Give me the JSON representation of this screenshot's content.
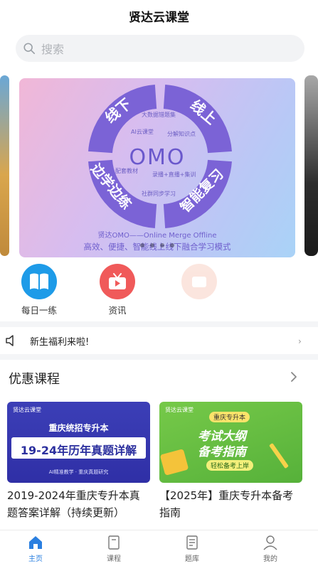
{
  "header": {
    "title": "贤达云课堂"
  },
  "search": {
    "placeholder": "搜索",
    "icon": "search-icon"
  },
  "banner": {
    "ring_words": [
      "线下",
      "线上",
      "边学边练",
      "智能复习"
    ],
    "center": "OMO",
    "mini_labels": [
      "大数据错题集",
      "AI云课堂",
      "分解知识点",
      "配套教材",
      "录播+直播+集训",
      "社群同步学习"
    ],
    "line1": "贤达OMO——Online Merge Offline",
    "line2": "高效、便捷、智能线上线下融合学习模式",
    "ring_color": "#7b63d6"
  },
  "quick_links": [
    {
      "label": "每日一练",
      "icon": "book-icon",
      "color": "#1e9be8"
    },
    {
      "label": "资讯",
      "icon": "tv-icon",
      "color": "#f05a5a"
    },
    {
      "label": "",
      "icon": "faded-icon",
      "color": "#f7c7b8"
    }
  ],
  "notice": {
    "text": "新生福利来啦!",
    "icon": "speaker-icon"
  },
  "section": {
    "title": "优惠课程"
  },
  "courses": [
    {
      "thumb_brand": "贤达云课堂",
      "thumb_line1": "重庆统招专升本",
      "thumb_line2": "19-24年历年真题详解",
      "thumb_line3": "AI精准教学 · 重庆真题研究",
      "title": "2019-2024年重庆专升本真题答案详解（持续更新）"
    },
    {
      "thumb_brand": "贤达云课堂",
      "thumb_line1": "重庆专升本",
      "thumb_line2": "考试大纲",
      "thumb_line3": "备考指南",
      "thumb_line4": "轻松备考上岸",
      "title": "【2025年】重庆专升本备考指南"
    }
  ],
  "tabbar": [
    {
      "label": "主页",
      "icon": "home-icon",
      "active": true
    },
    {
      "label": "课程",
      "icon": "course-icon",
      "active": false
    },
    {
      "label": "题库",
      "icon": "question-bank-icon",
      "active": false
    },
    {
      "label": "我的",
      "icon": "user-icon",
      "active": false
    }
  ],
  "colors": {
    "accent": "#2a7fe0"
  }
}
